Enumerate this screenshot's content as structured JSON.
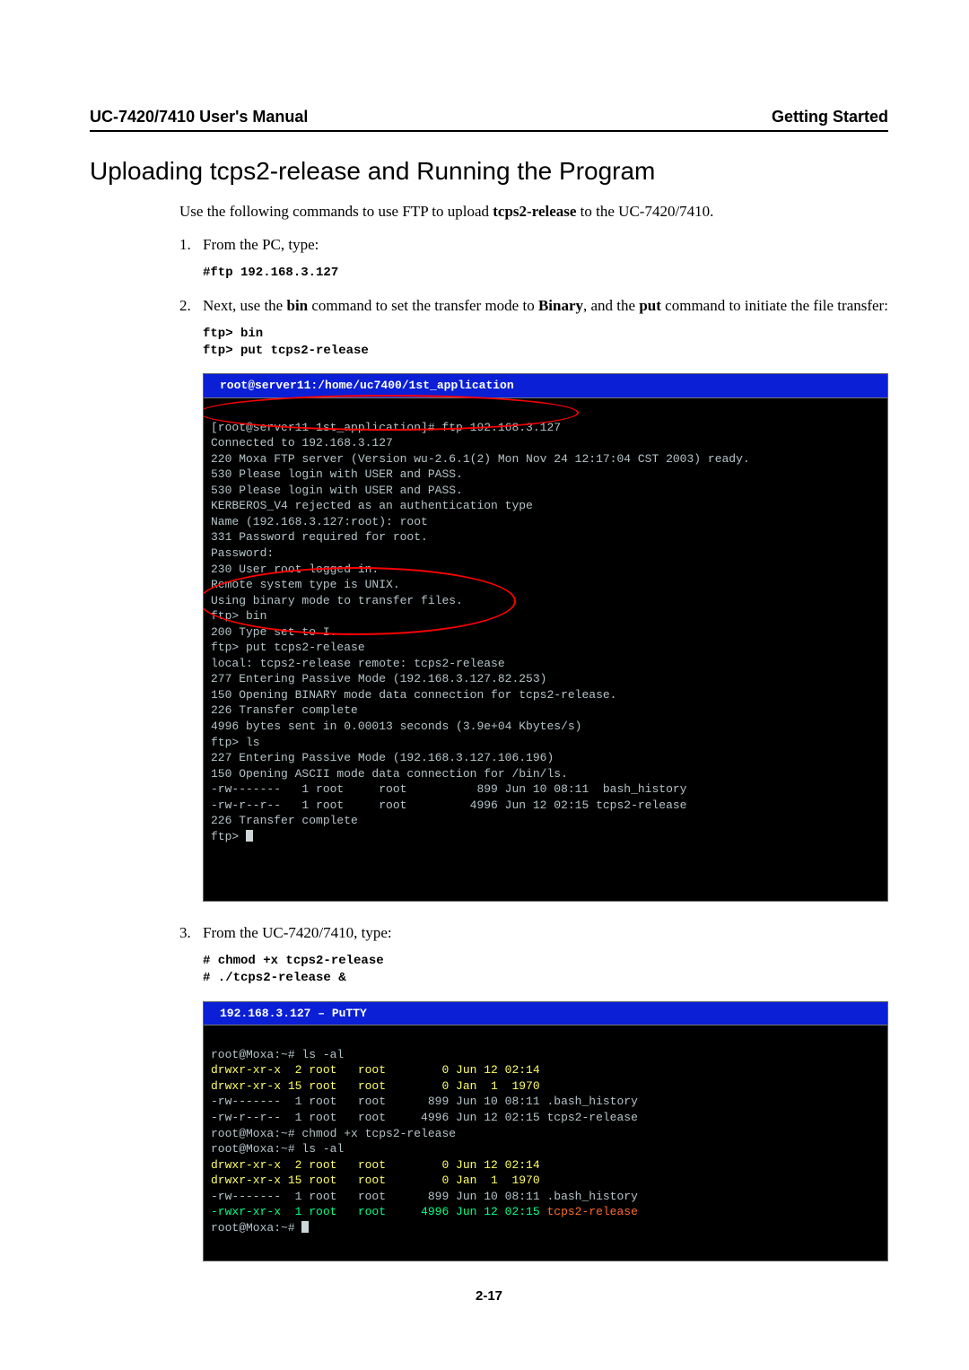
{
  "header": {
    "left": "UC-7420/7410 User's Manual",
    "right": "Getting Started"
  },
  "section_title": "Uploading tcps2-release and Running the Program",
  "intro_before_bold": "Use the following commands to use FTP to upload ",
  "intro_bold": "tcps2-release",
  "intro_after_bold": " to the UC-7420/7410.",
  "step1": {
    "num": "1.",
    "text": "From the PC, type:"
  },
  "code1": "#ftp 192.168.3.127",
  "step2": {
    "num": "2.",
    "p1": "Next, use the ",
    "b1": "bin",
    "p2": " command to set the transfer mode to ",
    "b2": "Binary",
    "p3": ", and the ",
    "b3": "put",
    "p4": " command to initiate the file transfer:"
  },
  "code2": "ftp> bin\nftp> put tcps2-release",
  "term1": {
    "title": "root@server11:/home/uc7400/1st_application",
    "lines": {
      "l01": "[root@server11 1st_application]# ftp 192.168.3.127",
      "l02": "Connected to 192.168.3.127",
      "l03": "220 Moxa FTP server (Version wu-2.6.1(2) Mon Nov 24 12:17:04 CST 2003) ready.",
      "l04": "530 Please login with USER and PASS.",
      "l05": "530 Please login with USER and PASS.",
      "l06": "KERBEROS_V4 rejected as an authentication type",
      "l07": "Name (192.168.3.127:root): root",
      "l08": "331 Password required for root.",
      "l09": "Password:",
      "l10": "230 User root logged in.",
      "l11": "Remote system type is UNIX.",
      "l12": "Using binary mode to transfer files.",
      "l13": "ftp> bin",
      "l14": "200 Type set to I.",
      "l15": "ftp> put tcps2-release",
      "l16": "local: tcps2-release remote: tcps2-release",
      "l17": "277 Entering Passive Mode (192.168.3.127.82.253)",
      "l18": "150 Opening BINARY mode data connection for tcps2-release.",
      "l19": "226 Transfer complete",
      "l20": "4996 bytes sent in 0.00013 seconds (3.9e+04 Kbytes/s)",
      "l21": "ftp> ls",
      "l22": "227 Entering Passive Mode (192.168.3.127.106.196)",
      "l23": "150 Opening ASCII mode data connection for /bin/ls.",
      "l24": "-rw-------   1 root     root          899 Jun 10 08:11  bash_history",
      "l25": "-rw-r--r--   1 root     root         4996 Jun 12 02:15 tcps2-release",
      "l26": "226 Transfer complete",
      "l27": "ftp> "
    }
  },
  "step3": {
    "num": "3.",
    "text": "From the UC-7420/7410, type:"
  },
  "code3": "# chmod +x tcps2-release\n# ./tcps2-release &",
  "term2": {
    "title": "192.168.3.127 – PuTTY",
    "lines": {
      "l01": "root@Moxa:~# ls -al",
      "l02": "drwxr-xr-x  2 root   root        0 Jun 12 02:14 ",
      "l03": "drwxr-xr-x 15 root   root        0 Jan  1  1970 ",
      "l04": "-rw-------  1 root   root      899 Jun 10 08:11 .bash_history",
      "l05": "-rw-r--r--  1 root   root     4996 Jun 12 02:15 tcps2-release",
      "l06": "root@Moxa:~# chmod +x tcps2-release",
      "l07": "root@Moxa:~# ls -al",
      "l08": "drwxr-xr-x  2 root   root        0 Jun 12 02:14 ",
      "l09": "drwxr-xr-x 15 root   root        0 Jan  1  1970 ",
      "l10": "-rw-------  1 root   root      899 Jun 10 08:11 .bash_history",
      "l11a": "-rwxr-xr-x  1 root   root     4996 Jun 12 02:15 ",
      "l11b": "tcps2-release",
      "l12": "root@Moxa:~# "
    }
  },
  "page_number": "2-17"
}
